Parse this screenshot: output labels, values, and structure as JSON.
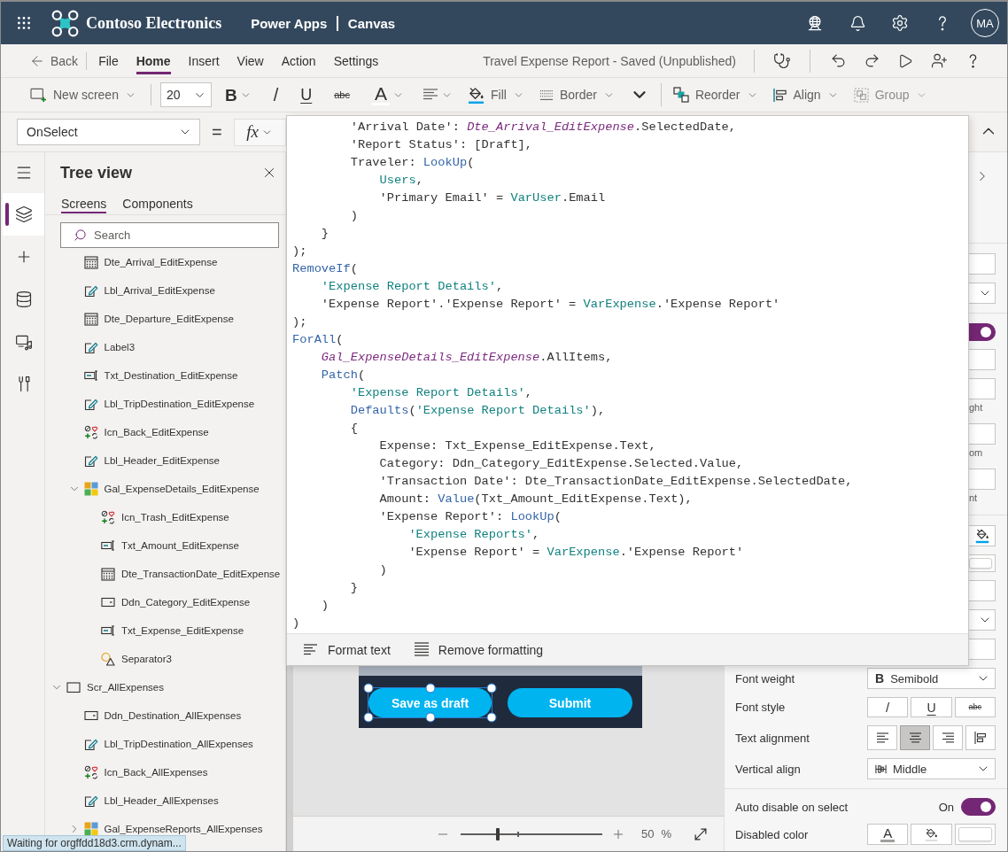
{
  "header": {
    "org_name": "Contoso Electronics",
    "product": "Power Apps",
    "mode": "Canvas",
    "avatar": "MA"
  },
  "menu": {
    "back": "Back",
    "tabs": [
      {
        "label": "File",
        "selected": false
      },
      {
        "label": "Home",
        "selected": true
      },
      {
        "label": "Insert",
        "selected": false
      },
      {
        "label": "View",
        "selected": false
      },
      {
        "label": "Action",
        "selected": false
      },
      {
        "label": "Settings",
        "selected": false
      }
    ],
    "document_title": "Travel Expense Report - Saved (Unpublished)"
  },
  "toolbar": {
    "new_screen": "New screen",
    "font_size": "20",
    "format_buttons": [
      {
        "label": "B",
        "kind": "bold"
      },
      {
        "label": "/",
        "kind": "italic"
      },
      {
        "label": "U",
        "kind": "underline"
      },
      {
        "label": "abc",
        "kind": "strike"
      },
      {
        "label": "A",
        "kind": "color"
      }
    ],
    "fill": "Fill",
    "border": "Border",
    "reorder": "Reorder",
    "align": "Align",
    "group": {
      "label": "Group",
      "disabled": true
    }
  },
  "formula_bar": {
    "property": "OnSelect",
    "equals": "=",
    "fx": "fx",
    "code": [
      {
        "tokens": [
          {
            "text": "        'Arrival Date': ",
            "kind": "plain"
          },
          {
            "text": "Dte_Arrival_EditExpense",
            "kind": "control"
          },
          {
            "text": ".SelectedDate,",
            "kind": "plain"
          }
        ]
      },
      {
        "tokens": [
          {
            "text": "        'Report Status': [Draft],",
            "kind": "plain"
          }
        ]
      },
      {
        "tokens": [
          {
            "text": "        Traveler: ",
            "kind": "plain"
          },
          {
            "text": "LookUp",
            "kind": "function"
          },
          {
            "text": "(",
            "kind": "plain"
          }
        ]
      },
      {
        "tokens": [
          {
            "text": "            Users",
            "kind": "reference"
          },
          {
            "text": ",",
            "kind": "plain"
          }
        ]
      },
      {
        "tokens": [
          {
            "text": "            'Primary Email' = ",
            "kind": "plain"
          },
          {
            "text": "VarUser",
            "kind": "reference"
          },
          {
            "text": ".Email",
            "kind": "plain"
          }
        ]
      },
      {
        "tokens": [
          {
            "text": "        )",
            "kind": "plain"
          }
        ]
      },
      {
        "tokens": [
          {
            "text": "    }",
            "kind": "plain"
          }
        ]
      },
      {
        "tokens": [
          {
            "text": ");",
            "kind": "plain"
          }
        ]
      },
      {
        "tokens": [
          {
            "text": "RemoveIf",
            "kind": "function"
          },
          {
            "text": "(",
            "kind": "plain"
          }
        ]
      },
      {
        "tokens": [
          {
            "text": "    'Expense Report Details'",
            "kind": "reference"
          },
          {
            "text": ",",
            "kind": "plain"
          }
        ]
      },
      {
        "tokens": [
          {
            "text": "    'Expense Report'.'Expense Report' = ",
            "kind": "plain"
          },
          {
            "text": "VarExpense",
            "kind": "reference"
          },
          {
            "text": ".'Expense Report'",
            "kind": "plain"
          }
        ]
      },
      {
        "tokens": [
          {
            "text": ");",
            "kind": "plain"
          }
        ]
      },
      {
        "tokens": [
          {
            "text": "ForAll",
            "kind": "function"
          },
          {
            "text": "(",
            "kind": "plain"
          }
        ]
      },
      {
        "tokens": [
          {
            "text": "    Gal_ExpenseDetails_EditExpense",
            "kind": "control"
          },
          {
            "text": ".AllItems,",
            "kind": "plain"
          }
        ]
      },
      {
        "tokens": [
          {
            "text": "    Patch",
            "kind": "function"
          },
          {
            "text": "(",
            "kind": "plain"
          }
        ]
      },
      {
        "tokens": [
          {
            "text": "        'Expense Report Details'",
            "kind": "reference"
          },
          {
            "text": ",",
            "kind": "plain"
          }
        ]
      },
      {
        "tokens": [
          {
            "text": "        Defaults",
            "kind": "function"
          },
          {
            "text": "(",
            "kind": "plain"
          },
          {
            "text": "'Expense Report Details'",
            "kind": "reference"
          },
          {
            "text": "),",
            "kind": "plain"
          }
        ]
      },
      {
        "tokens": [
          {
            "text": "        {",
            "kind": "plain"
          }
        ]
      },
      {
        "tokens": [
          {
            "text": "            Expense: Txt_Expense_EditExpense.Text,",
            "kind": "plain"
          }
        ]
      },
      {
        "tokens": [
          {
            "text": "            Category: Ddn_Category_EditExpense.Selected.Value,",
            "kind": "plain"
          }
        ]
      },
      {
        "tokens": [
          {
            "text": "            'Transaction Date': Dte_TransactionDate_EditExpense.SelectedDate,",
            "kind": "plain"
          }
        ]
      },
      {
        "tokens": [
          {
            "text": "            Amount: ",
            "kind": "plain"
          },
          {
            "text": "Value",
            "kind": "function"
          },
          {
            "text": "(Txt_Amount_EditExpense.Text),",
            "kind": "plain"
          }
        ]
      },
      {
        "tokens": [
          {
            "text": "            'Expense Report': ",
            "kind": "plain"
          },
          {
            "text": "LookUp",
            "kind": "function"
          },
          {
            "text": "(",
            "kind": "plain"
          }
        ]
      },
      {
        "tokens": [
          {
            "text": "                'Expense Reports'",
            "kind": "reference"
          },
          {
            "text": ",",
            "kind": "plain"
          }
        ]
      },
      {
        "tokens": [
          {
            "text": "                'Expense Report' = ",
            "kind": "plain"
          },
          {
            "text": "VarExpense",
            "kind": "reference"
          },
          {
            "text": ".'Expense Report'",
            "kind": "plain"
          }
        ]
      },
      {
        "tokens": [
          {
            "text": "            )",
            "kind": "plain"
          }
        ]
      },
      {
        "tokens": [
          {
            "text": "        }",
            "kind": "plain"
          }
        ]
      },
      {
        "tokens": [
          {
            "text": "    )",
            "kind": "plain"
          }
        ]
      },
      {
        "tokens": [
          {
            "text": ")",
            "kind": "plain"
          }
        ]
      }
    ],
    "format_text": "Format text",
    "remove_formatting": "Remove formatting"
  },
  "rail": [
    {
      "kind": "tree",
      "selected": true
    },
    {
      "kind": "insert",
      "selected": false
    },
    {
      "kind": "data",
      "selected": false
    },
    {
      "kind": "media",
      "selected": false
    },
    {
      "kind": "tools",
      "selected": false
    }
  ],
  "tree_view": {
    "title": "Tree view",
    "tabs": [
      {
        "label": "Screens",
        "selected": true
      },
      {
        "label": "Components",
        "selected": false
      }
    ],
    "search": {
      "placeholder": "Search"
    },
    "continued_items": [
      {
        "label": "Dte_Arrival_EditExpense",
        "kind": "date"
      },
      {
        "label": "Lbl_Arrival_EditExpense",
        "kind": "label"
      },
      {
        "label": "Dte_Departure_EditExpense",
        "kind": "date"
      },
      {
        "label": "Label3",
        "kind": "label"
      },
      {
        "label": "Txt_Destination_EditExpense",
        "kind": "text-input"
      },
      {
        "label": "Lbl_TripDestination_EditExpense",
        "kind": "label"
      },
      {
        "label": "Icn_Back_EditExpense",
        "kind": "icon"
      },
      {
        "label": "Lbl_Header_EditExpense",
        "kind": "label"
      },
      {
        "label": "Gal_ExpenseDetails_EditExpense",
        "kind": "gallery",
        "expanded": true,
        "children": [
          {
            "label": "Icn_Trash_EditExpense",
            "kind": "icon"
          },
          {
            "label": "Txt_Amount_EditExpense",
            "kind": "text-input"
          },
          {
            "label": "Dte_TransactionDate_EditExpense",
            "kind": "date"
          },
          {
            "label": "Ddn_Category_EditExpense",
            "kind": "dropdown"
          },
          {
            "label": "Txt_Expense_EditExpense",
            "kind": "text-input"
          },
          {
            "label": "Separator3",
            "kind": "shape"
          }
        ]
      }
    ],
    "screens": [
      {
        "label": "Scr_AllExpenses",
        "kind": "screen",
        "expanded": true,
        "children": [
          {
            "label": "Ddn_Destination_AllExpenses",
            "kind": "dropdown"
          },
          {
            "label": "Lbl_TripDestination_AllExpenses",
            "kind": "label"
          },
          {
            "label": "Icn_Back_AllExpenses",
            "kind": "icon"
          },
          {
            "label": "Lbl_Header_AllExpenses",
            "kind": "label"
          },
          {
            "label": "Gal_ExpenseReports_AllExpenses",
            "kind": "gallery",
            "expanded": false
          }
        ]
      }
    ]
  },
  "canvas": {
    "buttons": [
      {
        "label": "Save as draft",
        "selected": true
      },
      {
        "label": "Submit",
        "selected": false
      }
    ],
    "zoom": {
      "level": 0.26,
      "value": "50",
      "unit": "%"
    }
  },
  "properties": {
    "sections": [
      {
        "rows": [
          {
            "kind": "expand"
          }
        ]
      },
      {
        "rows": [
          {
            "kind": "field"
          },
          {
            "kind": "dropdown"
          }
        ]
      },
      {
        "rows": [
          {
            "kind": "toggle",
            "on": true
          },
          {
            "kind": "field"
          },
          {
            "kind": "field",
            "caption": "ght"
          },
          {
            "kind": "field",
            "caption": "om"
          },
          {
            "kind": "field",
            "caption": "nt"
          }
        ]
      },
      {
        "rows": [
          {
            "kind": "fill"
          },
          {
            "kind": "swatch"
          },
          {
            "kind": "field"
          },
          {
            "kind": "dropdown"
          },
          {
            "kind": "field"
          },
          {
            "kind": "font-weight",
            "label": "Font weight",
            "icon": "B",
            "value": "Semibold"
          },
          {
            "kind": "font-style",
            "label": "Font style",
            "buttons": [
              {
                "label": "/",
                "kind": "italic"
              },
              {
                "label": "U",
                "kind": "underline"
              },
              {
                "label": "abc",
                "kind": "strike"
              }
            ]
          },
          {
            "kind": "alignment",
            "label": "Text alignment",
            "options": [
              {
                "kind": "left",
                "selected": false
              },
              {
                "kind": "center",
                "selected": true
              },
              {
                "kind": "right",
                "selected": false
              },
              {
                "kind": "justify",
                "selected": false
              }
            ]
          },
          {
            "kind": "vertical-align",
            "label": "Vertical align",
            "value": "Middle"
          }
        ]
      },
      {
        "rows": [
          {
            "kind": "switch",
            "label": "Auto disable on select",
            "state": "On",
            "on": true
          },
          {
            "kind": "colors",
            "label": "Disabled color",
            "buttons": [
              {
                "kind": "text-color",
                "label": "A"
              },
              {
                "kind": "fill"
              },
              {
                "kind": "swatch"
              }
            ]
          }
        ]
      }
    ]
  },
  "status": "Waiting for orgffdd18d3.crm.dynam..."
}
